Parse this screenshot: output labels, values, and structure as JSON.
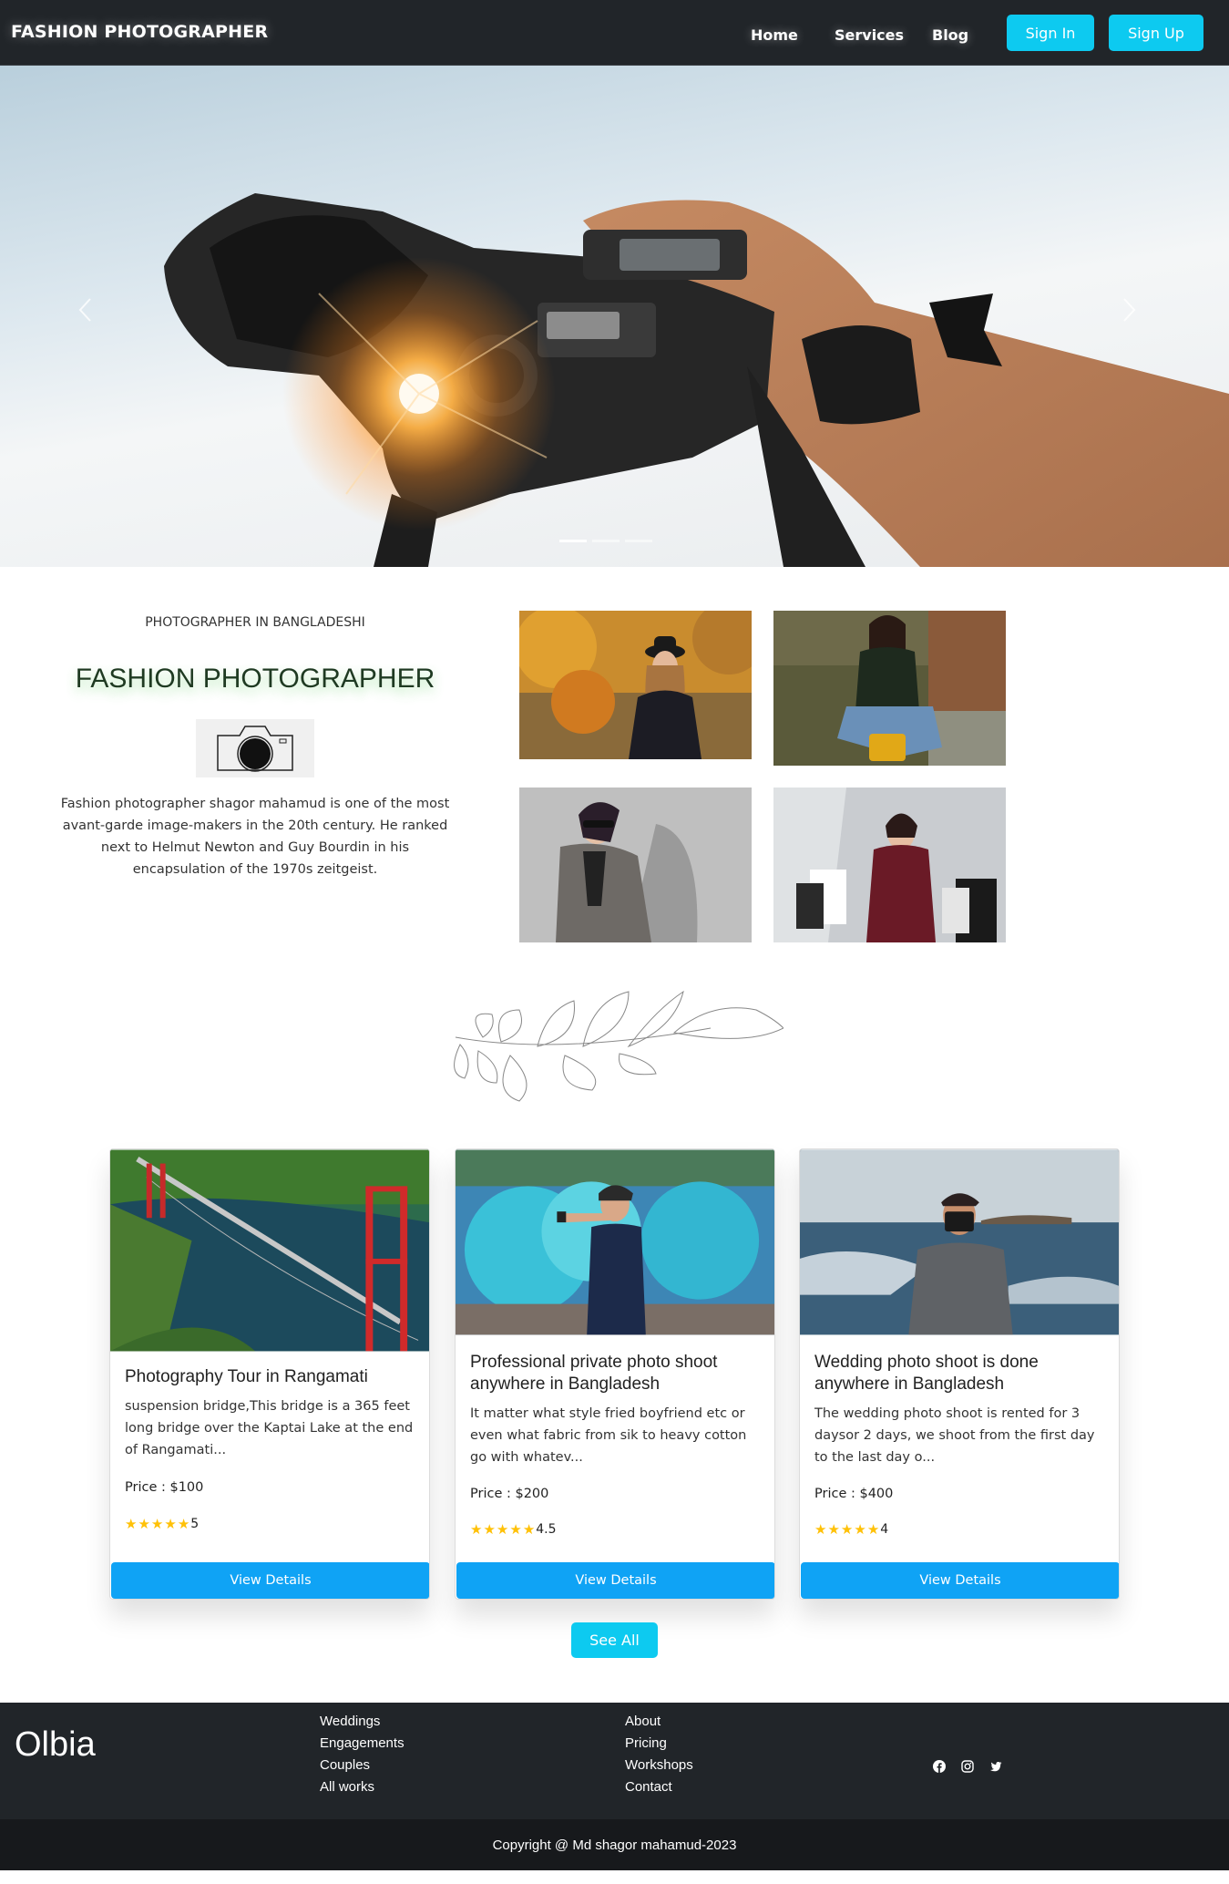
{
  "navbar": {
    "brand": "FASHION PHOTOGRAPHER",
    "links": [
      "Home",
      "Services",
      "Blog"
    ],
    "sign_in": "Sign In",
    "sign_up": "Sign Up",
    "accent_color": "#0dcaf0"
  },
  "hero": {
    "prev_icon": "chevron-left-icon",
    "next_icon": "chevron-right-icon"
  },
  "about": {
    "kicker": "PHOTOGRAPHER IN BANGLADESHI",
    "title": "FASHION PHOTOGRAPHER",
    "text": "Fashion photographer shagor mahamud is one of the most avant-garde image-makers in the 20th century. He ranked next to Helmut Newton and Guy Bourdin in his encapsulation of the 1970s zeitgeist."
  },
  "services": [
    {
      "title": "Photography Tour in Rangamati",
      "description": "suspension bridge,This bridge is a 365 feet long bridge over the Kaptai Lake at the end of Rangamati...",
      "price": "Price : $100",
      "rating": "5",
      "button": "View Details"
    },
    {
      "title": "Professional private photo shoot anywhere in Bangladesh",
      "description": "It matter what style fried boyfriend etc or even what fabric from sik to heavy cotton go with whatev...",
      "price": "Price : $200",
      "rating": "4.5",
      "button": "View Details"
    },
    {
      "title": "Wedding photo shoot is done anywhere in Bangladesh",
      "description": "The wedding photo shoot is rented for 3 daysor 2 days, we shoot from the first day to the last day o...",
      "price": "Price : $400",
      "rating": "4",
      "button": "View Details"
    }
  ],
  "see_all": "See All",
  "footer": {
    "logo": "Olbia",
    "col1": [
      "Weddings",
      "Engagements",
      "Couples",
      "All works"
    ],
    "col2": [
      "About",
      "Pricing",
      "Workshops",
      "Contact"
    ],
    "social_icons": [
      "facebook-icon",
      "instagram-icon",
      "twitter-icon"
    ],
    "copyright": "Copyright @ Md shagor mahamud-2023"
  }
}
